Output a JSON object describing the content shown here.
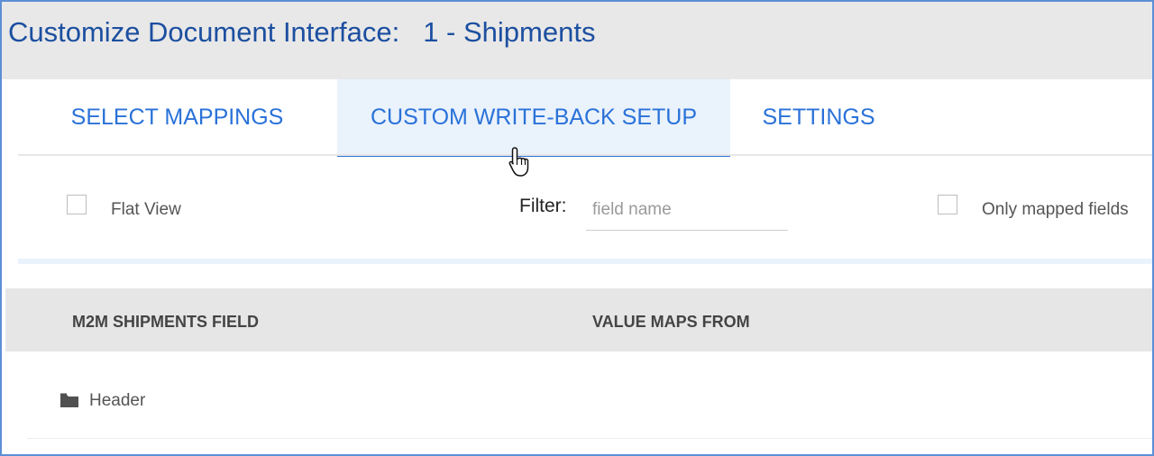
{
  "window": {
    "title": "Customize Document Interface:",
    "document": "1 - Shipments"
  },
  "tabs": [
    {
      "label": "SELECT MAPPINGS",
      "active": false
    },
    {
      "label": "CUSTOM WRITE-BACK SETUP",
      "active": true
    },
    {
      "label": "SETTINGS",
      "active": false
    }
  ],
  "toolbar": {
    "flat_view_label": "Flat View",
    "flat_view_checked": false,
    "filter_label": "Filter:",
    "filter_placeholder": "field name",
    "filter_value": "",
    "only_mapped_label": "Only mapped fields",
    "only_mapped_checked": false
  },
  "grid": {
    "columns": [
      "M2M SHIPMENTS FIELD",
      "VALUE MAPS FROM"
    ],
    "rows": [
      {
        "label": "Header",
        "icon": "folder-icon"
      }
    ]
  },
  "colors": {
    "title": "#1c4fa0",
    "tab_text": "#2a72d8",
    "active_tab_bg": "#eaf2fc",
    "frame_border": "#5b8fd6"
  },
  "cursor": "hand-pointer-icon"
}
